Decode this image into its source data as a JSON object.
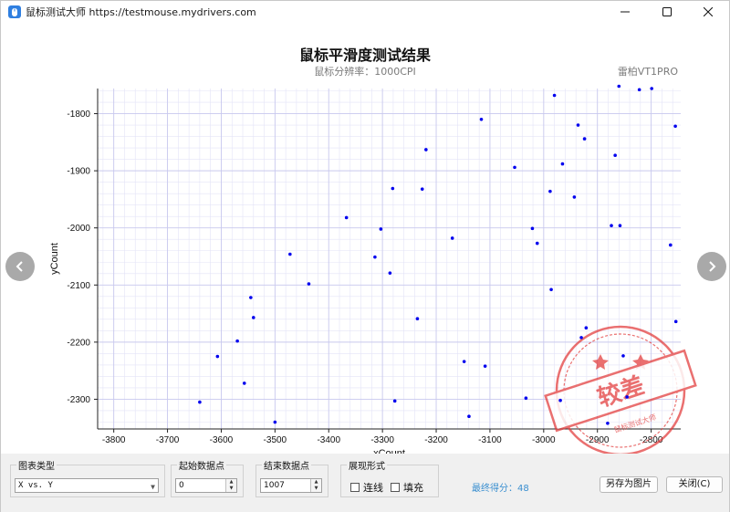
{
  "window": {
    "title": "鼠标测试大师 https://testmouse.mydrivers.com",
    "icons": [
      "app-icon",
      "minimize-icon",
      "maximize-icon",
      "close-icon"
    ]
  },
  "chart_title": "鼠标平滑度测试结果",
  "chart_subtitle": "鼠标分辨率：1000CPI",
  "device_name": "雷柏VT1PRO",
  "stamp": {
    "text": "较差",
    "ring_text": "鼠标测试大师",
    "color": "#e23a3a"
  },
  "chart_data": {
    "type": "scatter",
    "xlabel": "xCount",
    "ylabel": "yCount",
    "xlim": [
      -3830,
      -2745
    ],
    "ylim": [
      -2352,
      -1756
    ],
    "xticks": [
      -3800,
      -3700,
      -3600,
      -3500,
      -3400,
      -3300,
      -3200,
      -3100,
      -3000,
      -2900,
      -2800
    ],
    "yticks": [
      -1800,
      -1900,
      -2000,
      -2100,
      -2200,
      -2300
    ],
    "grid": true,
    "marker_color": "#0000ee",
    "points": [
      [
        -3640,
        -2305
      ],
      [
        -3607,
        -2225
      ],
      [
        -3570,
        -2198
      ],
      [
        -3557,
        -2272
      ],
      [
        -3545,
        -2122
      ],
      [
        -3540,
        -2157
      ],
      [
        -3500,
        -2340
      ],
      [
        -3472,
        -2046
      ],
      [
        -3437,
        -2098
      ],
      [
        -3367,
        -1982
      ],
      [
        -3314,
        -2051
      ],
      [
        -3303,
        -2002
      ],
      [
        -3286,
        -2079
      ],
      [
        -3281,
        -1931
      ],
      [
        -3277,
        -2303
      ],
      [
        -3235,
        -2159
      ],
      [
        -3226,
        -1932
      ],
      [
        -3219,
        -1863
      ],
      [
        -3170,
        -2018
      ],
      [
        -3148,
        -2234
      ],
      [
        -3139,
        -2330
      ],
      [
        -3116,
        -1810
      ],
      [
        -3109,
        -2242
      ],
      [
        -3054,
        -1894
      ],
      [
        -3033,
        -2298
      ],
      [
        -3021,
        -2001
      ],
      [
        -3012,
        -2027
      ],
      [
        -2988,
        -1936
      ],
      [
        -2986,
        -2108
      ],
      [
        -2980,
        -1768
      ],
      [
        -2969,
        -2302
      ],
      [
        -2965,
        -1888
      ],
      [
        -2943,
        -1946
      ],
      [
        -2936,
        -1820
      ],
      [
        -2930,
        -2192
      ],
      [
        -2924,
        -1844
      ],
      [
        -2921,
        -2175
      ],
      [
        -2881,
        -2342
      ],
      [
        -2874,
        -1996
      ],
      [
        -2867,
        -1873
      ],
      [
        -2860,
        -1752
      ],
      [
        -2858,
        -1996
      ],
      [
        -2852,
        -2224
      ],
      [
        -2845,
        -2296
      ],
      [
        -2822,
        -1758
      ],
      [
        -2799,
        -1756
      ],
      [
        -2764,
        -2030
      ],
      [
        -2755,
        -1822
      ],
      [
        -2754,
        -2164
      ]
    ]
  },
  "controls": {
    "chart_type_label": "图表类型",
    "chart_type_value": "X vs. Y",
    "start_label": "起始数据点",
    "start_value": "0",
    "end_label": "结束数据点",
    "end_value": "1007",
    "display_label": "展现形式",
    "line_option": "连线",
    "fill_option": "填充",
    "score_text": "最终得分：48",
    "save_image_label": "另存为图片",
    "close_label": "关闭(C)"
  }
}
